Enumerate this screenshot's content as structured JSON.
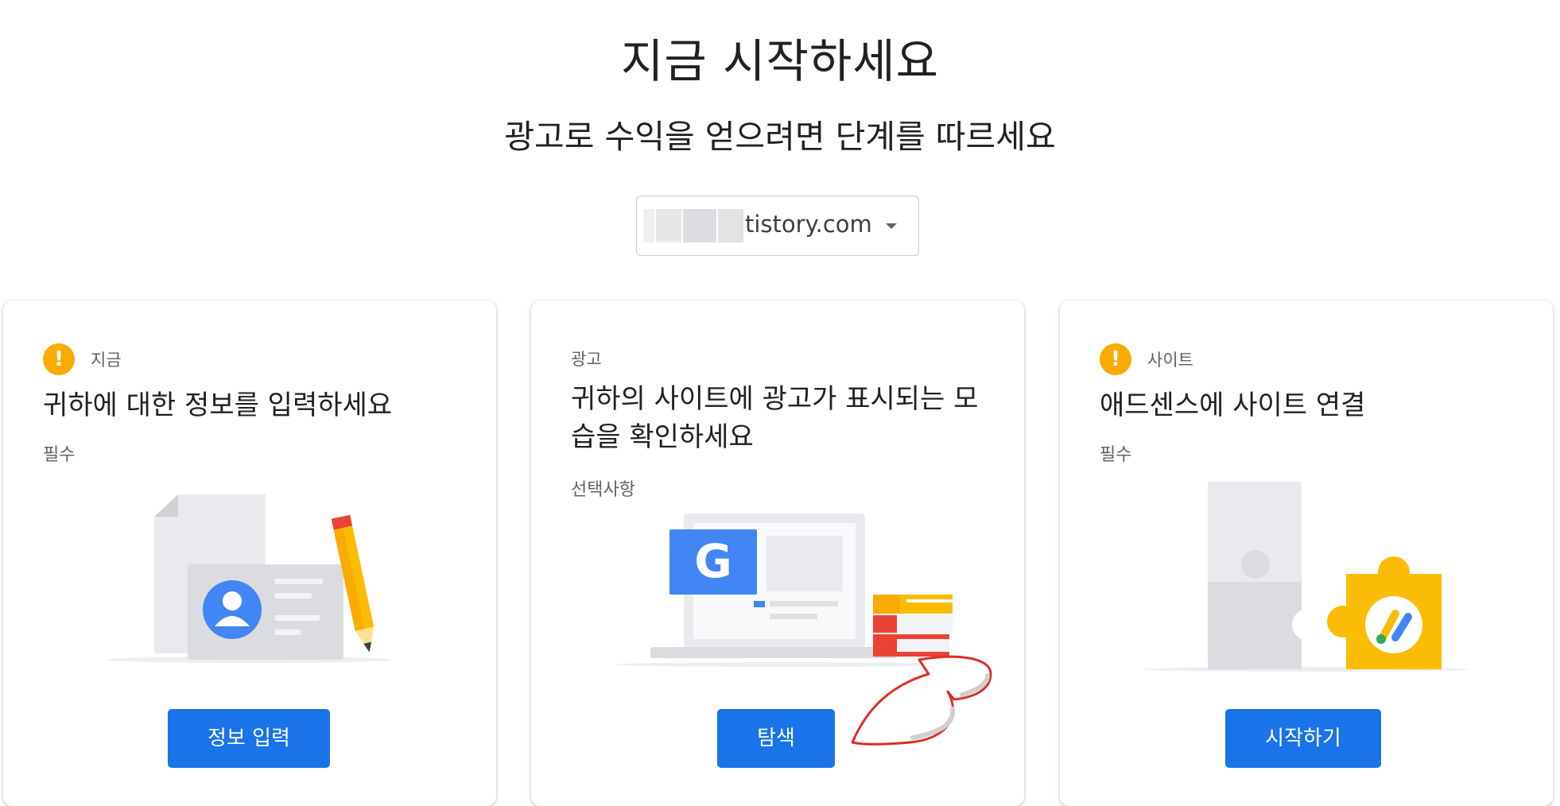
{
  "header": {
    "title": "지금 시작하세요",
    "subtitle": "광고로 수익을 얻으려면 단계를 따르세요"
  },
  "site_selector": {
    "selected_value": "tistory.com"
  },
  "cards": [
    {
      "status": "지금",
      "heading": "귀하에 대한 정보를 입력하세요",
      "requirement": "필수",
      "button": "정보 입력"
    },
    {
      "status": "광고",
      "heading": "귀하의 사이트에 광고가 표시되는 모습을 확인하세요",
      "requirement": "선택사항",
      "button": "탐색"
    },
    {
      "status": "사이트",
      "heading": "애드센스에 사이트 연결",
      "requirement": "필수",
      "button": "시작하기"
    }
  ],
  "colors": {
    "primary_button": "#1a73e8",
    "warning": "#f9ab00",
    "annotation_outline": "#d93025"
  }
}
